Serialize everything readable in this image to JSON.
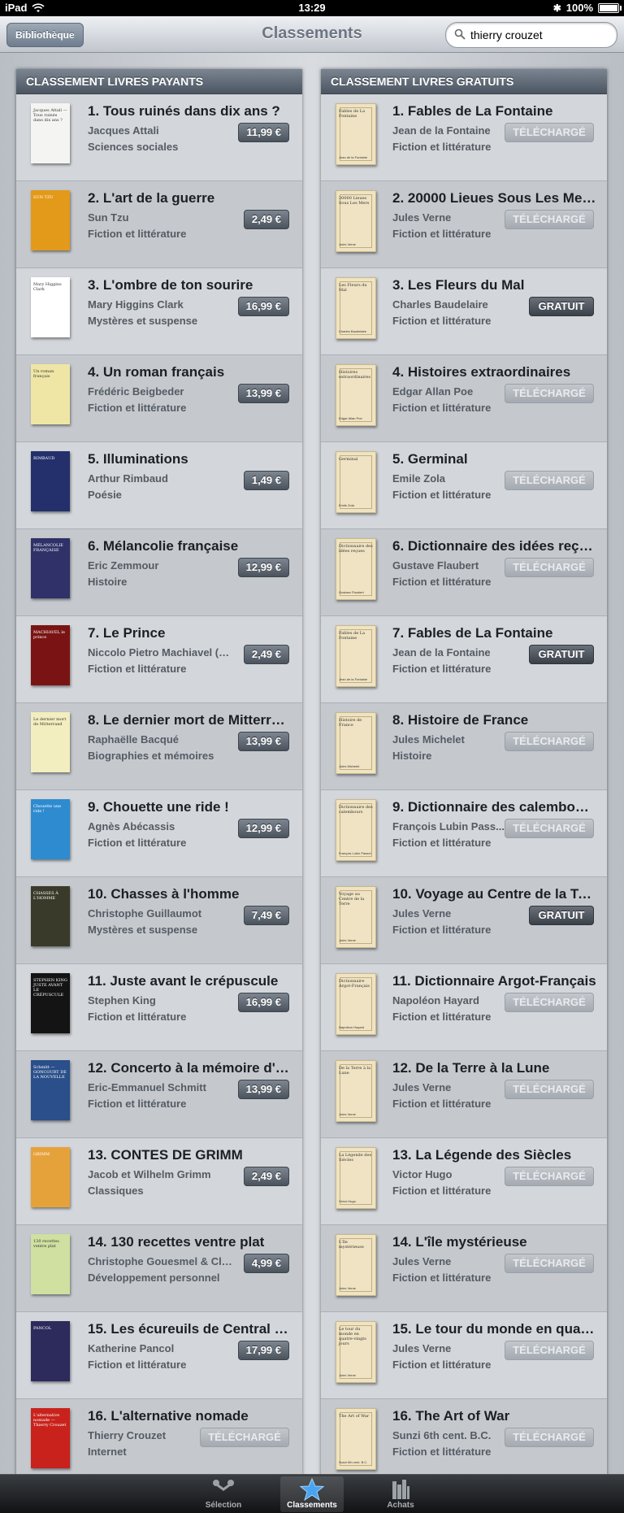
{
  "status_bar": {
    "device": "iPad",
    "time": "13:29",
    "battery": "100%"
  },
  "nav": {
    "back_label": "Bibliothèque",
    "title": "Classements",
    "search_value": "thierry crouzet"
  },
  "left_panel": {
    "header": "CLASSEMENT LIVRES PAYANTS",
    "items": [
      {
        "title": "1. Tous ruinés dans dix ans ?",
        "author": "Jacques Attali",
        "category": "Sciences sociales",
        "action": "11,99 €",
        "type": "price",
        "cover_color": "#f4f4f2",
        "cover_title": "Jacques Attali — Tous ruinés dans dix ans ?"
      },
      {
        "title": "2. L'art de la guerre",
        "author": "Sun Tzu",
        "category": "Fiction et littérature",
        "action": "2,49 €",
        "type": "price",
        "cover_color": "#e39a1a",
        "cover_title": "SUN TZU"
      },
      {
        "title": "3. L'ombre de ton sourire",
        "author": "Mary Higgins Clark",
        "category": "Mystères et suspense",
        "action": "16,99 €",
        "type": "price",
        "cover_color": "#ffffff",
        "cover_title": "Mary Higgins Clark"
      },
      {
        "title": "4. Un roman français",
        "author": "Frédéric Beigbeder",
        "category": "Fiction et littérature",
        "action": "13,99 €",
        "type": "price",
        "cover_color": "#efe6a6",
        "cover_title": "Un roman français"
      },
      {
        "title": "5. Illuminations",
        "author": "Arthur Rimbaud",
        "category": "Poésie",
        "action": "1,49 €",
        "type": "price",
        "cover_color": "#23306b",
        "cover_title": "RIMBAUD"
      },
      {
        "title": "6. Mélancolie française",
        "author": "Eric Zemmour",
        "category": "Histoire",
        "action": "12,99 €",
        "type": "price",
        "cover_color": "#2f3168",
        "cover_title": "MÉLANCOLIE FRANÇAISE"
      },
      {
        "title": "7. Le Prince",
        "author": "Niccolo Pietro Machiavel (Ma...",
        "category": "Fiction et littérature",
        "action": "2,49 €",
        "type": "price",
        "cover_color": "#7a1414",
        "cover_title": "MACHIAVEL le prince"
      },
      {
        "title": "8. Le dernier mort de Mitterrand",
        "author": "Raphaëlle Bacqué",
        "category": "Biographies et mémoires",
        "action": "13,99 €",
        "type": "price",
        "cover_color": "#f3eebf",
        "cover_title": "Le dernier mort de Mitterrand"
      },
      {
        "title": "9. Chouette une ride !",
        "author": "Agnès Abécassis",
        "category": "Fiction et littérature",
        "action": "12,99 €",
        "type": "price",
        "cover_color": "#2f8bcf",
        "cover_title": "Chouette une ride !"
      },
      {
        "title": "10. Chasses à l'homme",
        "author": "Christophe Guillaumot",
        "category": "Mystères et suspense",
        "action": "7,49 €",
        "type": "price",
        "cover_color": "#3a3a2a",
        "cover_title": "CHASSES À L'HOMME"
      },
      {
        "title": "11. Juste avant le crépuscule",
        "author": "Stephen King",
        "category": "Fiction et littérature",
        "action": "16,99 €",
        "type": "price",
        "cover_color": "#141414",
        "cover_title": "STEPHEN KING JUSTE AVANT LE CRÉPUSCULE"
      },
      {
        "title": "12. Concerto à la mémoire d'u...",
        "author": "Eric-Emmanuel Schmitt",
        "category": "Fiction et littérature",
        "action": "13,99 €",
        "type": "price",
        "cover_color": "#2a4f8a",
        "cover_title": "Schmitt — GONCOURT DE LA NOUVELLE"
      },
      {
        "title": "13. CONTES DE GRIMM",
        "author": "Jacob et Wilhelm Grimm",
        "category": "Classiques",
        "action": "2,49 €",
        "type": "price",
        "cover_color": "#e6a23a",
        "cover_title": "GRIMM"
      },
      {
        "title": "14. 130 recettes ventre plat",
        "author": "Christophe Gouesmel & Clair...",
        "category": "Développement personnel",
        "action": "4,99 €",
        "type": "price",
        "cover_color": "#cfe0a0",
        "cover_title": "130 recettes ventre plat"
      },
      {
        "title": "15. Les écureuils de Central P...",
        "author": "Katherine Pancol",
        "category": "Fiction et littérature",
        "action": "17,99 €",
        "type": "price",
        "cover_color": "#2d2a5c",
        "cover_title": "PANCOL"
      },
      {
        "title": "16. L'alternative nomade",
        "author": "Thierry Crouzet",
        "category": "Internet",
        "action": "TÉLÉCHARGÉ",
        "type": "done",
        "cover_color": "#c9221c",
        "cover_title": "L'alternative nomade — Thierry Crouzet"
      }
    ]
  },
  "right_panel": {
    "header": "CLASSEMENT LIVRES GRATUITS",
    "items": [
      {
        "title": "1. Fables de La Fontaine",
        "author": "Jean de la Fontaine",
        "category": "Fiction et littérature",
        "action": "TÉLÉCHARGÉ",
        "type": "done",
        "cover_title": "Fables de La Fontaine",
        "cover_author": "Jean de la Fontaine"
      },
      {
        "title": "2. 20000 Lieues Sous Les Mer...",
        "author": "Jules Verne",
        "category": "Fiction et littérature",
        "action": "TÉLÉCHARGÉ",
        "type": "done",
        "cover_title": "20000 Lieues Sous Les Mers",
        "cover_author": "Jules Verne"
      },
      {
        "title": "3. Les Fleurs du Mal",
        "author": "Charles Baudelaire",
        "category": "Fiction et littérature",
        "action": "GRATUIT",
        "type": "gratuit",
        "cover_title": "Les Fleurs du Mal",
        "cover_author": "Charles Baudelaire"
      },
      {
        "title": "4. Histoires extraordinaires",
        "author": "Edgar Allan Poe",
        "category": "Fiction et littérature",
        "action": "TÉLÉCHARGÉ",
        "type": "done",
        "cover_title": "Histoires extraordinaires",
        "cover_author": "Edgar Allan Poe"
      },
      {
        "title": "5. Germinal",
        "author": "Emile Zola",
        "category": "Fiction et littérature",
        "action": "TÉLÉCHARGÉ",
        "type": "done",
        "cover_title": "Germinal",
        "cover_author": "Emile Zola"
      },
      {
        "title": "6. Dictionnaire des idées reçues",
        "author": "Gustave Flaubert",
        "category": "Fiction et littérature",
        "action": "TÉLÉCHARGÉ",
        "type": "done",
        "cover_title": "Dictionnaire des idées reçues",
        "cover_author": "Gustave Flaubert"
      },
      {
        "title": "7. Fables de La Fontaine",
        "author": "Jean de la Fontaine",
        "category": "Fiction et littérature",
        "action": "GRATUIT",
        "type": "gratuit",
        "cover_title": "Fables de La Fontaine",
        "cover_author": "Jean de la Fontaine"
      },
      {
        "title": "8. Histoire de France",
        "author": "Jules Michelet",
        "category": "Histoire",
        "action": "TÉLÉCHARGÉ",
        "type": "done",
        "cover_title": "Histoire de France",
        "cover_author": "Jules Michelet"
      },
      {
        "title": "9. Dictionnaire des calembour...",
        "author": "François Lubin Pass...",
        "category": "Fiction et littérature",
        "action": "TÉLÉCHARGÉ",
        "type": "done",
        "cover_title": "Dictionnaire des calembours",
        "cover_author": "François Lubin Passot"
      },
      {
        "title": "10. Voyage au Centre de la Terre",
        "author": "Jules Verne",
        "category": "Fiction et littérature",
        "action": "GRATUIT",
        "type": "gratuit",
        "cover_title": "Voyage au Centre de la Terre",
        "cover_author": "Jules Verne"
      },
      {
        "title": "11. Dictionnaire Argot-Français",
        "author": "Napoléon Hayard",
        "category": "Fiction et littérature",
        "action": "TÉLÉCHARGÉ",
        "type": "done",
        "cover_title": "Dictionnaire Argot-Français",
        "cover_author": "Napoléon Hayard"
      },
      {
        "title": "12. De la Terre à la Lune",
        "author": "Jules Verne",
        "category": "Fiction et littérature",
        "action": "TÉLÉCHARGÉ",
        "type": "done",
        "cover_title": "De la Terre à la Lune",
        "cover_author": "Jules Verne"
      },
      {
        "title": "13. La Légende des Siècles",
        "author": "Victor Hugo",
        "category": "Fiction et littérature",
        "action": "TÉLÉCHARGÉ",
        "type": "done",
        "cover_title": "La Légende des Siècles",
        "cover_author": "Victor Hugo"
      },
      {
        "title": "14. L'île mystérieuse",
        "author": "Jules Verne",
        "category": "Fiction et littérature",
        "action": "TÉLÉCHARGÉ",
        "type": "done",
        "cover_title": "L'île mystérieuse",
        "cover_author": "Jules Verne"
      },
      {
        "title": "15. Le tour du monde en quatr...",
        "author": "Jules Verne",
        "category": "Fiction et littérature",
        "action": "TÉLÉCHARGÉ",
        "type": "done",
        "cover_title": "Le tour du monde en quatre-vingts jours",
        "cover_author": "Jules Verne"
      },
      {
        "title": "16. The Art of War",
        "author": "Sunzi 6th cent. B.C.",
        "category": "Fiction et littérature",
        "action": "TÉLÉCHARGÉ",
        "type": "done",
        "cover_title": "The Art of War",
        "cover_author": "Sunzi 6th cent. B.C."
      }
    ]
  },
  "tab_bar": {
    "tabs": [
      {
        "label": "Sélection",
        "icon": "selection-icon",
        "active": false
      },
      {
        "label": "Classements",
        "icon": "star-icon",
        "active": true
      },
      {
        "label": "Achats",
        "icon": "books-icon",
        "active": false
      }
    ]
  }
}
